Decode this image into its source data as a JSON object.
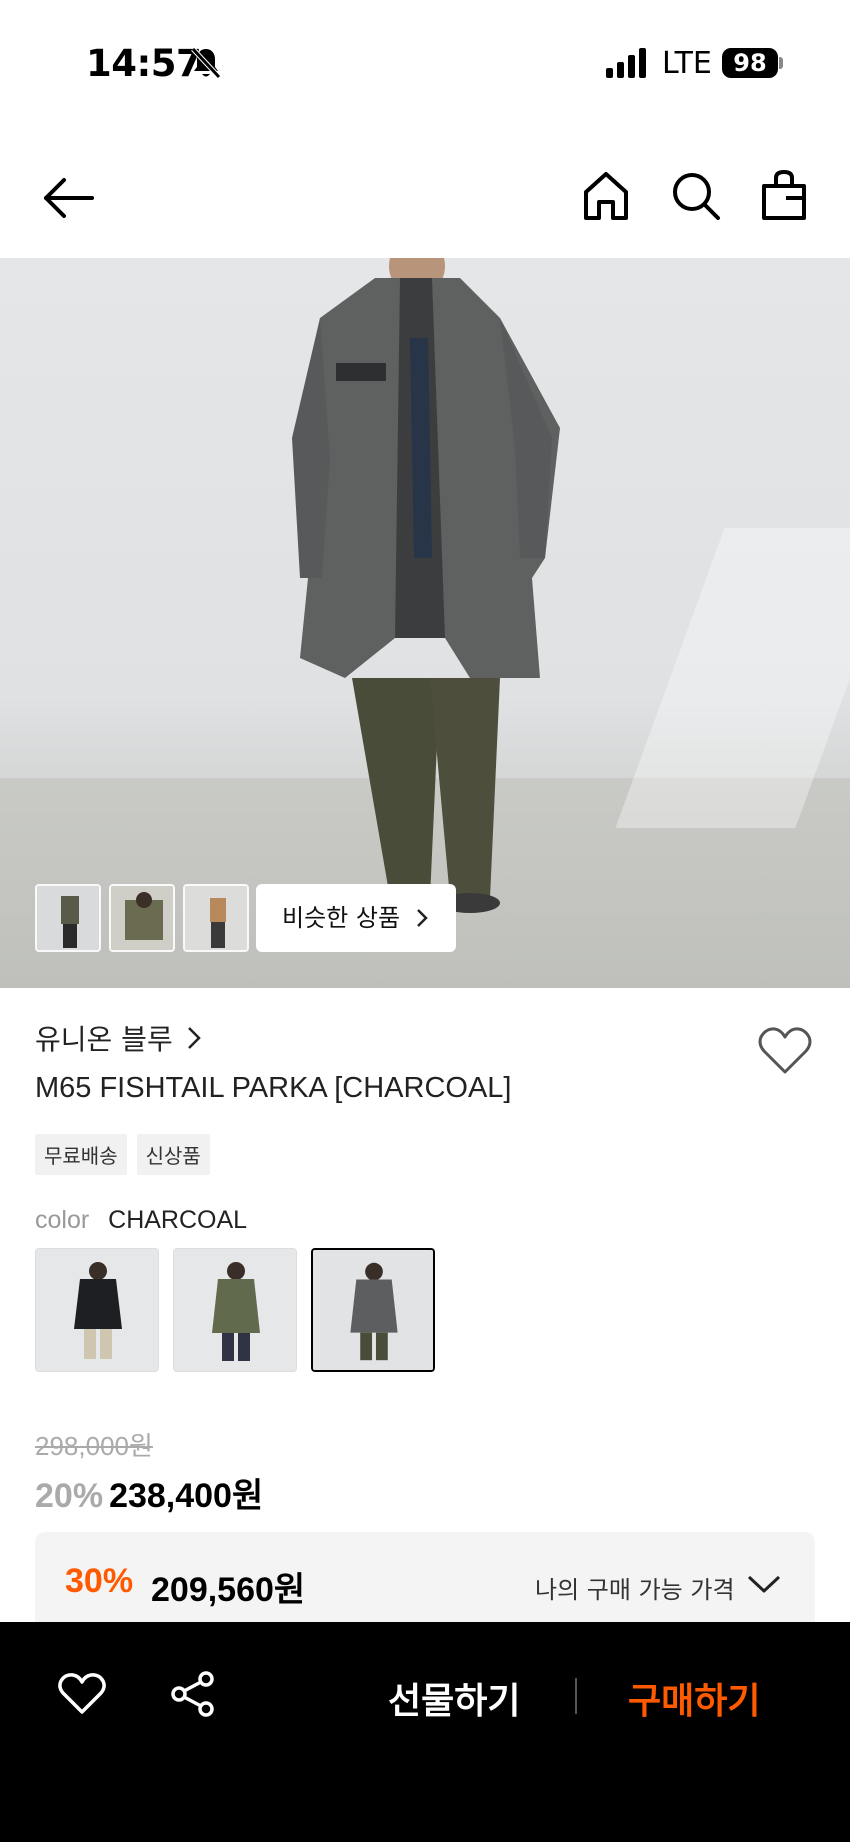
{
  "status_bar": {
    "time": "14:57",
    "network": "LTE",
    "battery": "98"
  },
  "hero": {
    "similar_button": "비슷한 상품"
  },
  "product": {
    "brand": "유니온 블루",
    "title": "M65 FISHTAIL PARKA [CHARCOAL]",
    "tags": [
      "무료배송",
      "신상품"
    ],
    "color_label": "color",
    "color_value": "CHARCOAL",
    "original_price": "298,000원",
    "discount": "20%",
    "price": "238,400원"
  },
  "my_price": {
    "discount": "30%",
    "price": "209,560원",
    "label": "나의 구매 가능 가격",
    "accent_color": "#ff5a00"
  },
  "bottom_bar": {
    "gift_label": "선물하기",
    "buy_label": "구매하기"
  }
}
